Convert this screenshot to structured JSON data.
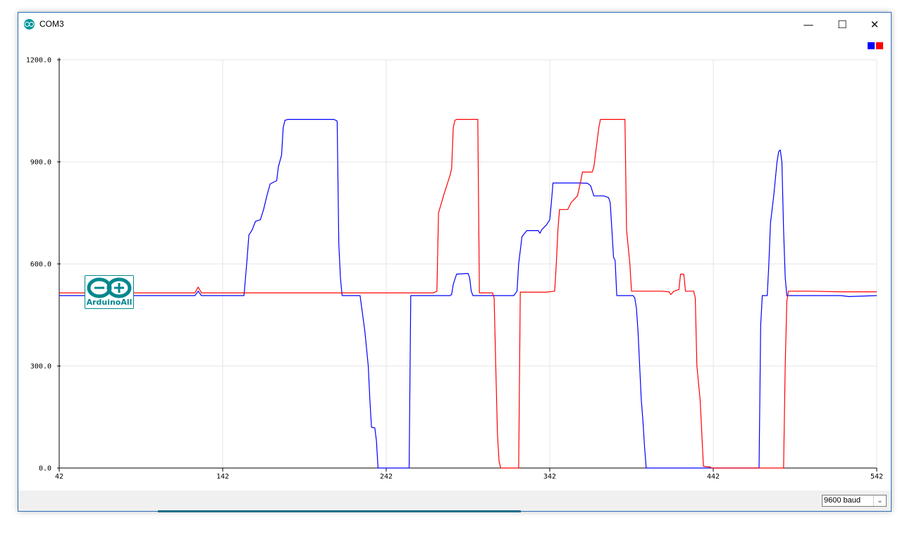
{
  "window": {
    "title": "COM3",
    "controls": {
      "minimize": "—",
      "maximize": "☐",
      "close": "✕"
    }
  },
  "logo": {
    "text": "ArduinoAll"
  },
  "bottom_bar": {
    "baud_selected": "9600 baud"
  },
  "colors": {
    "series1": "#0000ff",
    "series2": "#ff0000",
    "logo": "#00878f"
  },
  "chart_data": {
    "type": "line",
    "title": "",
    "xlabel": "",
    "ylabel": "",
    "xlim": [
      42,
      542
    ],
    "ylim": [
      0,
      1200
    ],
    "x_ticks": [
      "42",
      "142",
      "242",
      "342",
      "442",
      "542"
    ],
    "y_ticks": [
      "0.0",
      "300.0",
      "600.0",
      "900.0",
      "1200.0"
    ],
    "grid": true,
    "legend": "top-right",
    "series": [
      {
        "color": "#0000ff",
        "points": [
          [
            42,
            507
          ],
          [
            125,
            507
          ],
          [
            127,
            520
          ],
          [
            129,
            507
          ],
          [
            155,
            507
          ],
          [
            157,
            620
          ],
          [
            158,
            685
          ],
          [
            160,
            700
          ],
          [
            162,
            725
          ],
          [
            165,
            730
          ],
          [
            167,
            760
          ],
          [
            169,
            800
          ],
          [
            171,
            835
          ],
          [
            173,
            840
          ],
          [
            175,
            845
          ],
          [
            176,
            885
          ],
          [
            178,
            920
          ],
          [
            179,
            1000
          ],
          [
            180,
            1022
          ],
          [
            182,
            1025
          ],
          [
            195,
            1025
          ],
          [
            210,
            1025
          ],
          [
            212,
            1020
          ],
          [
            213,
            660
          ],
          [
            214,
            560
          ],
          [
            215,
            507
          ],
          [
            226,
            507
          ],
          [
            229,
            400
          ],
          [
            231,
            300
          ],
          [
            232,
            200
          ],
          [
            233,
            120
          ],
          [
            235,
            118
          ],
          [
            236,
            80
          ],
          [
            237,
            0
          ],
          [
            256,
            0
          ],
          [
            257,
            507
          ],
          [
            260,
            507
          ],
          [
            281,
            507
          ],
          [
            282,
            510
          ],
          [
            283,
            540
          ],
          [
            285,
            570
          ],
          [
            292,
            572
          ],
          [
            293,
            560
          ],
          [
            294,
            520
          ],
          [
            295,
            507
          ],
          [
            320,
            507
          ],
          [
            322,
            520
          ],
          [
            323,
            600
          ],
          [
            325,
            680
          ],
          [
            328,
            698
          ],
          [
            335,
            698
          ],
          [
            336,
            690
          ],
          [
            337,
            700
          ],
          [
            340,
            715
          ],
          [
            342,
            730
          ],
          [
            343,
            780
          ],
          [
            344,
            838
          ],
          [
            353,
            838
          ],
          [
            360,
            838
          ],
          [
            365,
            837
          ],
          [
            367,
            830
          ],
          [
            369,
            800
          ],
          [
            375,
            800
          ],
          [
            378,
            795
          ],
          [
            379,
            780
          ],
          [
            380,
            700
          ],
          [
            381,
            620
          ],
          [
            382,
            610
          ],
          [
            383,
            507
          ],
          [
            393,
            507
          ],
          [
            394,
            500
          ],
          [
            395,
            470
          ],
          [
            396,
            400
          ],
          [
            397,
            300
          ],
          [
            398,
            200
          ],
          [
            399,
            140
          ],
          [
            400,
            60
          ],
          [
            401,
            0
          ],
          [
            470,
            0
          ],
          [
            471,
            420
          ],
          [
            472,
            507
          ],
          [
            475,
            507
          ],
          [
            476,
            600
          ],
          [
            477,
            720
          ],
          [
            479,
            800
          ],
          [
            481,
            900
          ],
          [
            482,
            930
          ],
          [
            483,
            935
          ],
          [
            484,
            900
          ],
          [
            485,
            700
          ],
          [
            486,
            560
          ],
          [
            487,
            507
          ],
          [
            520,
            507
          ],
          [
            525,
            504
          ],
          [
            542,
            507
          ]
        ]
      },
      {
        "color": "#ff0000",
        "points": [
          [
            42,
            515
          ],
          [
            60,
            515
          ],
          [
            80,
            515
          ],
          [
            100,
            515
          ],
          [
            125,
            515
          ],
          [
            127,
            532
          ],
          [
            129,
            515
          ],
          [
            150,
            515
          ],
          [
            200,
            515
          ],
          [
            230,
            515
          ],
          [
            250,
            515
          ],
          [
            271,
            515
          ],
          [
            273,
            520
          ],
          [
            274,
            750
          ],
          [
            277,
            800
          ],
          [
            279,
            830
          ],
          [
            281,
            860
          ],
          [
            282,
            880
          ],
          [
            283,
            1000
          ],
          [
            284,
            1022
          ],
          [
            285,
            1025
          ],
          [
            298,
            1025
          ],
          [
            299,
            515
          ],
          [
            301,
            515
          ],
          [
            307,
            515
          ],
          [
            308,
            500
          ],
          [
            309,
            300
          ],
          [
            310,
            100
          ],
          [
            311,
            20
          ],
          [
            312,
            0
          ],
          [
            323,
            0
          ],
          [
            324,
            517
          ],
          [
            325,
            517
          ],
          [
            340,
            517
          ],
          [
            345,
            520
          ],
          [
            346,
            600
          ],
          [
            347,
            700
          ],
          [
            348,
            760
          ],
          [
            353,
            760
          ],
          [
            355,
            780
          ],
          [
            357,
            790
          ],
          [
            359,
            800
          ],
          [
            361,
            845
          ],
          [
            362,
            870
          ],
          [
            368,
            870
          ],
          [
            369,
            885
          ],
          [
            372,
            1000
          ],
          [
            373,
            1025
          ],
          [
            388,
            1025
          ],
          [
            389,
            700
          ],
          [
            391,
            600
          ],
          [
            392,
            520
          ],
          [
            400,
            520
          ],
          [
            410,
            520
          ],
          [
            415,
            518
          ],
          [
            416,
            510
          ],
          [
            418,
            520
          ],
          [
            421,
            525
          ],
          [
            422,
            570
          ],
          [
            424,
            570
          ],
          [
            425,
            520
          ],
          [
            430,
            520
          ],
          [
            431,
            500
          ],
          [
            432,
            300
          ],
          [
            434,
            200
          ],
          [
            435,
            100
          ],
          [
            436,
            5
          ],
          [
            440,
            3
          ],
          [
            441,
            0
          ],
          [
            472,
            0
          ],
          [
            485,
            0
          ],
          [
            486,
            300
          ],
          [
            487,
            490
          ],
          [
            488,
            520
          ],
          [
            500,
            520
          ],
          [
            520,
            518
          ],
          [
            542,
            518
          ]
        ]
      }
    ]
  }
}
